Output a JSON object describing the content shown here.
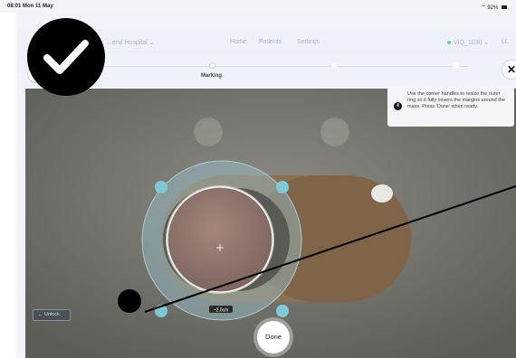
{
  "status_bar": {
    "time": "08:01  Mon 11 May",
    "battery": "92%"
  },
  "nav": {
    "hospital": "...end Hospital ⌄",
    "links": [
      "Home",
      "Patients",
      "Settings"
    ],
    "user": "VIQ_1030  ⌄",
    "initials": "LL"
  },
  "stepper": {
    "active_label": "Marking",
    "left_label": "",
    "right_label": ""
  },
  "buttons": {
    "back": "←",
    "close": "✕",
    "unlock": "← Unlock",
    "done": "Done"
  },
  "tooltip": {
    "step": "4",
    "text": "Use the corner handles to resize the outer ring so it fully covers the margins around the mass. Press 'Done' when ready."
  },
  "measurement": {
    "label": "~2.0cm"
  },
  "colors": {
    "accent": "#7fc8d6",
    "camera_bg": "#7d7d76",
    "badge": "#000000"
  },
  "icons": {
    "badge": "check-icon",
    "back": "arrow-left-icon",
    "close": "close-icon",
    "crosshair": "crosshair-icon",
    "wifi": "wifi-icon"
  }
}
